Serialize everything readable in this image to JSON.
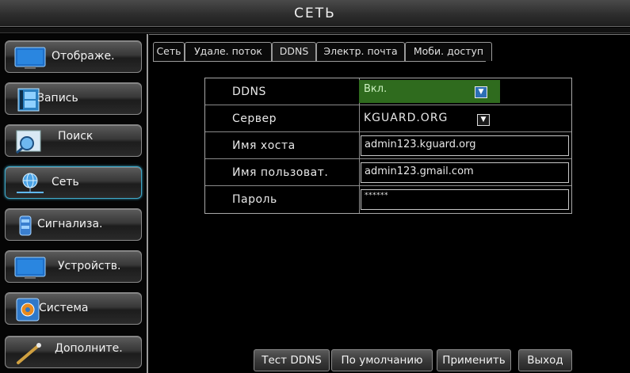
{
  "title": "СЕТЬ",
  "sidebar": {
    "items": [
      {
        "label": "Отображе.",
        "icon": "monitor-icon"
      },
      {
        "label": "Запись",
        "icon": "film-icon"
      },
      {
        "label": "Поиск",
        "icon": "magnifier-icon"
      },
      {
        "label": "Сеть",
        "icon": "globe-network-icon",
        "active": true
      },
      {
        "label": "Сигнализа.",
        "icon": "siren-icon"
      },
      {
        "label": "Устройств.",
        "icon": "device-monitor-icon"
      },
      {
        "label": "Система",
        "icon": "gear-icon"
      },
      {
        "label": "Дополните.",
        "icon": "tool-icon"
      }
    ]
  },
  "tabs": [
    {
      "label": "Сеть"
    },
    {
      "label": "Удале. поток"
    },
    {
      "label": "DDNS",
      "active": true
    },
    {
      "label": "Электр. почта"
    },
    {
      "label": "Моби. доступ"
    }
  ],
  "form": {
    "ddns_label": "DDNS",
    "ddns_value": "Вкл.",
    "server_label": "Сервер",
    "server_value": "KGUARD.ORG",
    "hostname_label": "Имя хоста",
    "hostname_value": "admin123.kguard.org",
    "username_label": "Имя пользоват.",
    "username_value": "admin123.gmail.com",
    "password_label": "Пароль",
    "password_value": "******"
  },
  "buttons": {
    "test": "Тест DDNS",
    "default": "По умолчанию",
    "apply": "Применить",
    "exit": "Выход"
  },
  "colors": {
    "accent_active": "#3fa9c9",
    "ddns_on": "#2f6b1e",
    "dropdown_blue": "#2d6fb5"
  }
}
